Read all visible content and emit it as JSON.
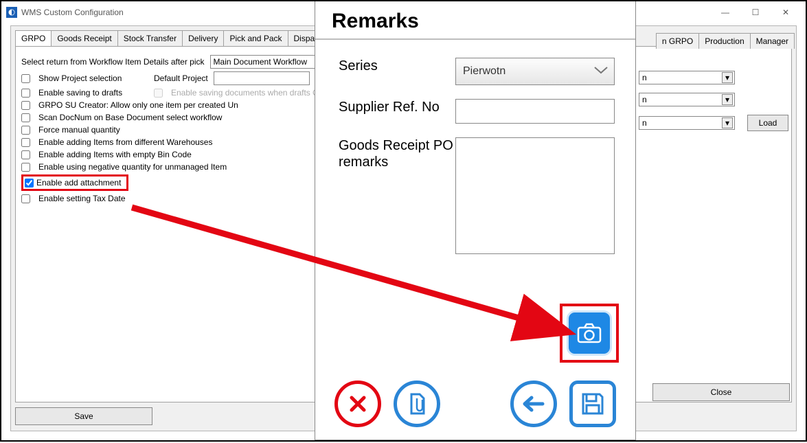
{
  "window": {
    "title": "WMS Custom Configuration",
    "sysicons": {
      "min": "—",
      "max": "☐",
      "close": "✕"
    }
  },
  "tabs": [
    "GRPO",
    "Goods Receipt",
    "Stock Transfer",
    "Delivery",
    "Pick and Pack",
    "Dispatch Control"
  ],
  "tabs_right": [
    "n GRPO",
    "Production",
    "Manager"
  ],
  "form": {
    "selectReturnLabel": "Select return from Workflow Item Details after pick",
    "selectReturnValue": "Main Document Workflow",
    "showProject": "Show Project selection",
    "defaultProjectLabel": "Default Project",
    "enableDrafts": "Enable saving to drafts",
    "enableDraftsDocs": "Enable saving documents when drafts ON",
    "suCreator": "GRPO SU Creator: Allow only one item per created Un",
    "scanDocnum": "Scan DocNum on Base Document select workflow",
    "forceQty": "Force manual quantity",
    "diffWh": "Enable adding Items from different Warehouses",
    "emptyBin": "Enable adding Items with empty Bin Code",
    "negQty": "Enable using negative quantity for unmanaged Item",
    "addAttach": "Enable add attachment",
    "taxDate": "Enable setting Tax Date"
  },
  "rightDropdowns": [
    "n",
    "n",
    "n"
  ],
  "loadBtn": "Load",
  "saveBtn": "Save",
  "closeBtn": "Close",
  "remarks": {
    "title": "Remarks",
    "seriesLabel": "Series",
    "seriesValue": "Pierwotn",
    "supplierLabel": "Supplier Ref. No",
    "goodsLabel": "Goods Receipt PO remarks",
    "icons": {
      "cancel": "cancel-icon",
      "attach": "attachments-icon",
      "back": "back-icon",
      "save": "save-icon",
      "camera": "camera-icon"
    }
  }
}
